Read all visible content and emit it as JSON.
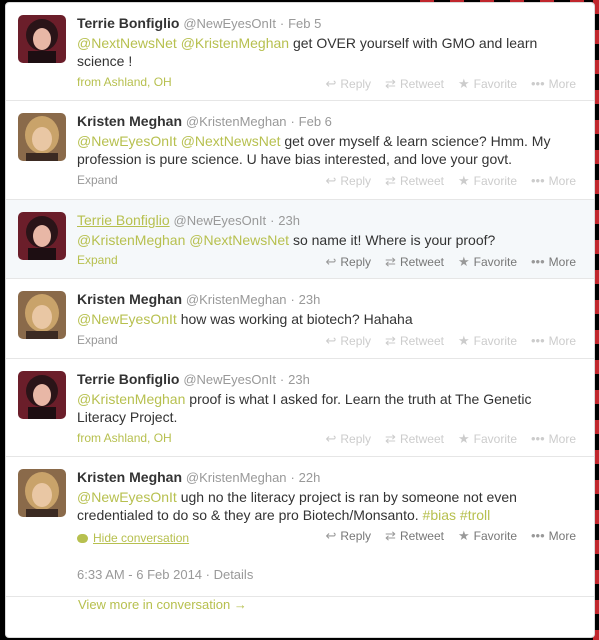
{
  "actions": {
    "reply": "Reply",
    "retweet": "Retweet",
    "favorite": "Favorite",
    "more": "More"
  },
  "tweets": [
    {
      "name": "Terrie Bonfiglio",
      "handle": "@NewEyesOnIt",
      "sep": "·",
      "time": "Feb 5",
      "mentions": [
        "@NextNewsNet",
        "@KristenMeghan"
      ],
      "text": "get OVER yourself with GMO and learn science !",
      "meta": "from Ashland, OH"
    },
    {
      "name": "Kristen Meghan",
      "handle": "@KristenMeghan",
      "sep": "·",
      "time": "Feb 6",
      "mentions": [
        "@NewEyesOnIt",
        "@NextNewsNet"
      ],
      "text": "get over myself & learn science?  Hmm. My profession is pure science. U have bias interested, and love your govt.",
      "meta": "Expand"
    },
    {
      "name": "Terrie Bonfiglio",
      "handle": "@NewEyesOnIt",
      "sep": "·",
      "time": "23h",
      "mentions": [
        "@KristenMeghan",
        "@NextNewsNet"
      ],
      "text": "so name it! Where is your proof?",
      "meta": "Expand"
    },
    {
      "name": "Kristen Meghan",
      "handle": "@KristenMeghan",
      "sep": "·",
      "time": "23h",
      "mentions": [
        "@NewEyesOnIt"
      ],
      "text": "how was working at biotech?  Hahaha",
      "meta": "Expand"
    },
    {
      "name": "Terrie Bonfiglio",
      "handle": "@NewEyesOnIt",
      "sep": "·",
      "time": "23h",
      "mentions": [
        "@KristenMeghan"
      ],
      "text": "proof is what I asked for. Learn the truth at The Genetic Literacy Project.",
      "meta": "from Ashland, OH"
    },
    {
      "name": "Kristen Meghan",
      "handle": "@KristenMeghan",
      "sep": "·",
      "time": "22h",
      "mentions": [
        "@NewEyesOnIt"
      ],
      "text": "ugh no the literacy project is ran by someone not even credentialed to do so & they are pro Biotech/Monsanto.",
      "hashtags": [
        "#bias",
        "#troll"
      ],
      "meta": "Hide conversation",
      "details": "6:33 AM - 6 Feb 2014 · Details"
    }
  ],
  "view_more": "View more in conversation →"
}
